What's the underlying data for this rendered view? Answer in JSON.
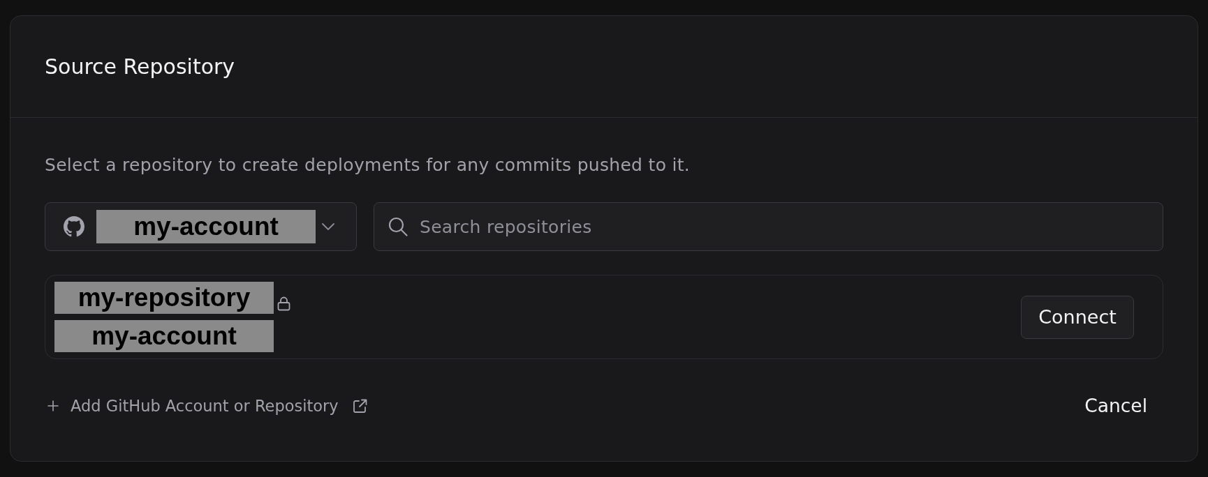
{
  "dialog": {
    "title": "Source Repository"
  },
  "description": "Select a repository to create deployments for any commits pushed to it.",
  "account_select": {
    "value": "my-account"
  },
  "search": {
    "placeholder": "Search repositories"
  },
  "repositories": [
    {
      "name": "my-repository",
      "owner": "my-account",
      "private": true,
      "action": "Connect"
    }
  ],
  "footer": {
    "add_link": "Add GitHub Account or Repository",
    "cancel": "Cancel"
  }
}
